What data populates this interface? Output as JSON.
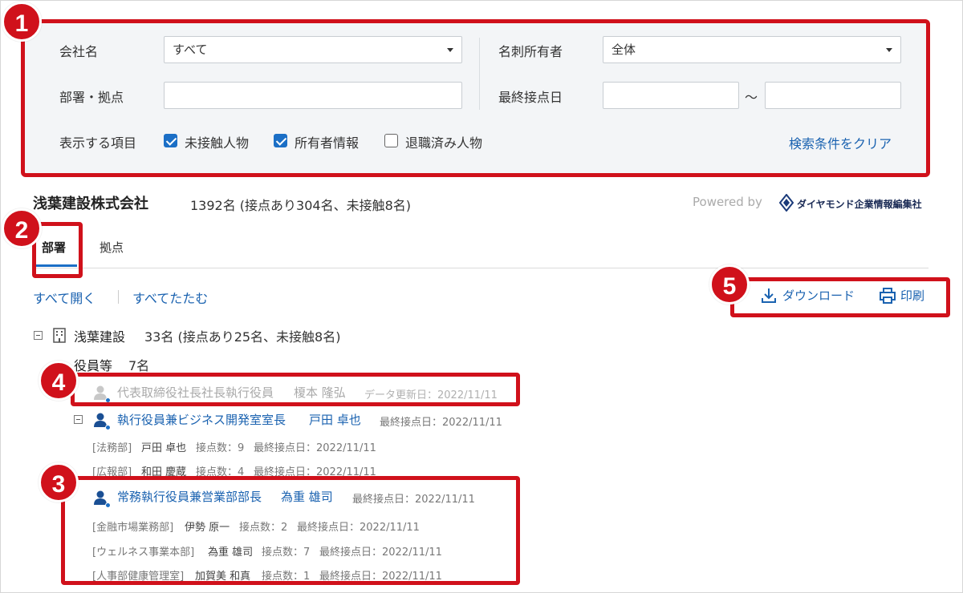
{
  "filters": {
    "company_label": "会社名",
    "company_value": "すべて",
    "owner_label": "名刺所有者",
    "owner_value": "全体",
    "dept_label": "部署・拠点",
    "last_contact_label": "最終接点日",
    "range_sep": "～",
    "display_label": "表示する項目",
    "opt1": "未接触人物",
    "opt2": "所有者情報",
    "opt3": "退職済み人物",
    "clear": "検索条件をクリア"
  },
  "header": {
    "company": "浅葉建設株式会社",
    "summary": "1392名 (接点あり304名、未接触8名)",
    "powered_by": "Powered by",
    "logo_text": "ダイヤモンド企業情報編集社"
  },
  "tabs": {
    "tab1": "部署",
    "tab2": "拠点"
  },
  "actions": {
    "expand_all": "すべて開く",
    "collapse_all": "すべてたたむ",
    "download": "ダウンロード",
    "print": "印刷"
  },
  "tree": {
    "root_name": "浅葉建設",
    "root_count": "33名 (接点あり25名、未接触8名)",
    "group_name": "役員等",
    "group_count": "7名",
    "p1_title": "代表取締役社長社長執行役員",
    "p1_name": "榎本 隆弘",
    "p1_meta": "データ更新日：2022/11/11",
    "p2_title": "執行役員兼ビジネス開発室室長",
    "p2_name": "戸田 卓也",
    "p2_meta": "最終接点日：2022/11/11",
    "p2_sub1_dept": "[法務部]",
    "p2_sub1_name": "戸田 卓也",
    "p2_sub1_count": "接点数：9",
    "p2_sub1_date": "最終接点日：2022/11/11",
    "p2_sub2_dept": "[広報部]",
    "p2_sub2_name": "和田 慶蔵",
    "p2_sub2_count": "接点数：4",
    "p2_sub2_date": "最終接点日：2022/11/11",
    "p3_title": "常務執行役員兼営業部部長",
    "p3_name": "為重 雄司",
    "p3_meta": "最終接点日：2022/11/11",
    "p3_sub1_dept": "[金融市場業務部]",
    "p3_sub1_name": "伊勢 原一",
    "p3_sub1_count": "接点数：2",
    "p3_sub1_date": "最終接点日：2022/11/11",
    "p3_sub2_dept": "[ウェルネス事業本部]",
    "p3_sub2_name": "為重 雄司",
    "p3_sub2_count": "接点数：7",
    "p3_sub2_date": "最終接点日：2022/11/11",
    "p3_sub3_dept": "[人事部健康管理室]",
    "p3_sub3_name": "加賀美 和真",
    "p3_sub3_count": "接点数：1",
    "p3_sub3_date": "最終接点日：2022/11/11"
  },
  "badges": {
    "b1": "1",
    "b2": "2",
    "b3": "3",
    "b4": "4",
    "b5": "5"
  },
  "colors": {
    "accent": "#1a62b0",
    "callout": "#d0111b",
    "panel": "#f3f5f7"
  }
}
